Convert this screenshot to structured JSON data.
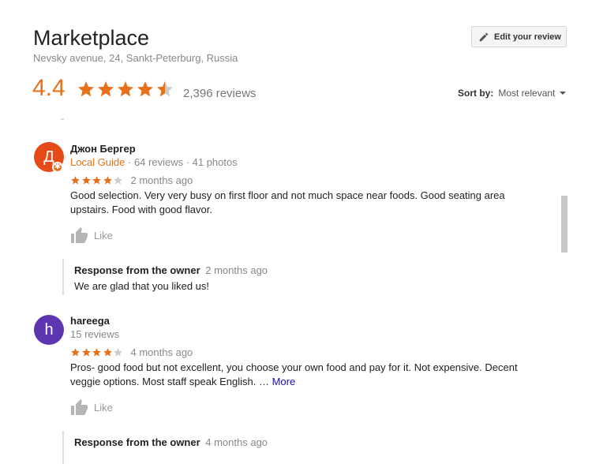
{
  "place": {
    "title": "Marketplace",
    "address": "Nevsky avenue, 24, Sankt-Peterburg, Russia",
    "rating": "4.4",
    "rating_value": 4.4,
    "reviews_count": "2,396 reviews"
  },
  "edit_button": {
    "label": "Edit your review",
    "icon": "pencil-icon"
  },
  "sort": {
    "label": "Sort by:",
    "value": "Most relevant"
  },
  "colors": {
    "accent": "#e7711b",
    "star_empty": "#cccccc",
    "link": "#1a0dab",
    "avatar_1": "#e64a19",
    "avatar_2": "#5e35b1"
  },
  "reviews": [
    {
      "avatar_letter": "Д",
      "author": "Джон Бергер",
      "guide_label": "Local Guide",
      "stats": " · 64 reviews · 41 photos",
      "stars": 4,
      "when": "2 months ago",
      "text": "Good selection.  Very very busy on first floor and not much space near foods.  Good seating area upstairs.  Food with good flavor.",
      "like_label": "Like",
      "response": {
        "title": "Response from the owner",
        "when": "2 months ago",
        "text": "We are glad that you liked us!"
      }
    },
    {
      "avatar_letter": "h",
      "author": "hareega",
      "stats": "15 reviews",
      "stars": 4,
      "when": "4 months ago",
      "text": "Pros- good food but not excellent, you choose your own food and pay for it. Not expensive. Decent veggie options. Most staff speak English. … ",
      "more_label": "More",
      "like_label": "Like",
      "response": {
        "title": "Response from the owner",
        "when": "4 months ago"
      }
    }
  ]
}
